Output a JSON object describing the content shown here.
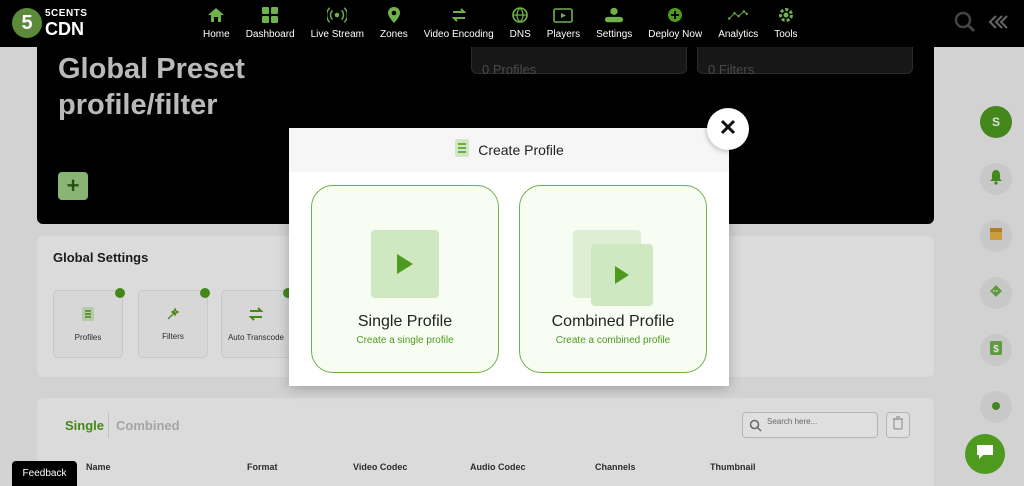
{
  "brand": {
    "line1": "5CENTS",
    "line2": "CDN",
    "badge": "5",
    "color": "#4e9a1e"
  },
  "nav": {
    "items": [
      {
        "label": "Home",
        "icon": "home-icon"
      },
      {
        "label": "Dashboard",
        "icon": "dashboard-icon"
      },
      {
        "label": "Live Stream",
        "icon": "live-stream-icon"
      },
      {
        "label": "Zones",
        "icon": "location-pin-icon"
      },
      {
        "label": "Video Encoding",
        "icon": "encoding-icon"
      },
      {
        "label": "DNS",
        "icon": "globe-icon"
      },
      {
        "label": "Players",
        "icon": "player-icon"
      },
      {
        "label": "Settings",
        "icon": "settings-icon"
      },
      {
        "label": "Deploy Now",
        "icon": "plus-circle-icon"
      },
      {
        "label": "Analytics",
        "icon": "analytics-icon"
      },
      {
        "label": "Tools",
        "icon": "gear-icon"
      }
    ],
    "right_icons": [
      "search-icon",
      "collapse-icon"
    ]
  },
  "hero": {
    "title": "Global Preset profile/filter",
    "stat_profiles": "0 Profiles",
    "stat_filters": "0 Filters"
  },
  "global_settings": {
    "title": "Global Settings",
    "cards": [
      {
        "label": "Profiles",
        "icon": "profiles-icon"
      },
      {
        "label": "Filters",
        "icon": "filters-icon"
      },
      {
        "label": "Auto Transcode",
        "icon": "transcode-icon"
      }
    ]
  },
  "table": {
    "tabs": [
      "Single",
      "Combined"
    ],
    "search_placeholder": "Search here...",
    "columns": [
      "Name",
      "Format",
      "Video Codec",
      "Audio Codec",
      "Channels",
      "Thumbnail"
    ]
  },
  "rail": {
    "avatar_letter": "S",
    "icons": [
      "bell-icon",
      "package-icon",
      "diamond-icon",
      "dollar-icon",
      "dot-icon"
    ]
  },
  "modal": {
    "title": "Create Profile",
    "options": [
      {
        "title": "Single Profile",
        "subtitle": "Create a single profile"
      },
      {
        "title": "Combined Profile",
        "subtitle": "Create a combined profile"
      }
    ]
  },
  "feedback_label": "Feedback"
}
